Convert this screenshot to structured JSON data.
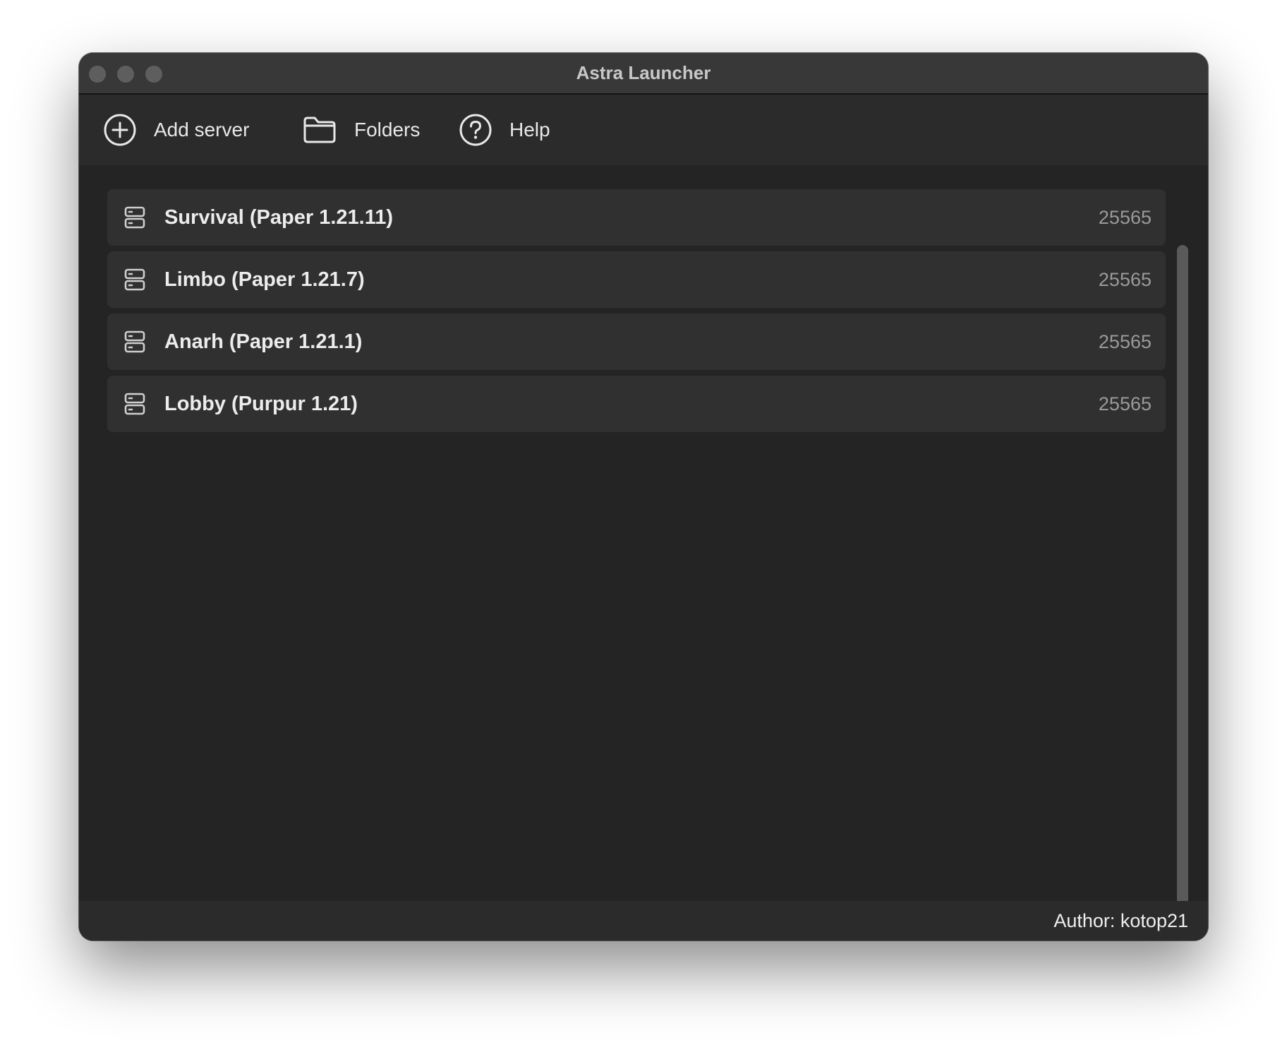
{
  "window": {
    "title": "Astra Launcher"
  },
  "toolbar": {
    "add_server": {
      "label": "Add server",
      "icon": "plus-circle-icon"
    },
    "folders": {
      "label": "Folders",
      "icon": "folder-icon"
    },
    "help": {
      "label": "Help",
      "icon": "question-circle-icon"
    }
  },
  "servers": [
    {
      "name": "Survival (Paper 1.21.11)",
      "port": "25565",
      "icon": "server-icon"
    },
    {
      "name": "Limbo (Paper 1.21.7)",
      "port": "25565",
      "icon": "server-icon"
    },
    {
      "name": "Anarh (Paper 1.21.1)",
      "port": "25565",
      "icon": "server-icon"
    },
    {
      "name": "Lobby (Purpur 1.21)",
      "port": "25565",
      "icon": "server-icon"
    }
  ],
  "status": {
    "author": "Author: kotop21"
  },
  "colors": {
    "window_bg": "#242424",
    "titlebar_bg": "#383838",
    "toolbar_bg": "#2b2b2b",
    "row_bg": "#303030",
    "text_primary": "#ececec",
    "text_secondary": "#9a9a9a"
  }
}
